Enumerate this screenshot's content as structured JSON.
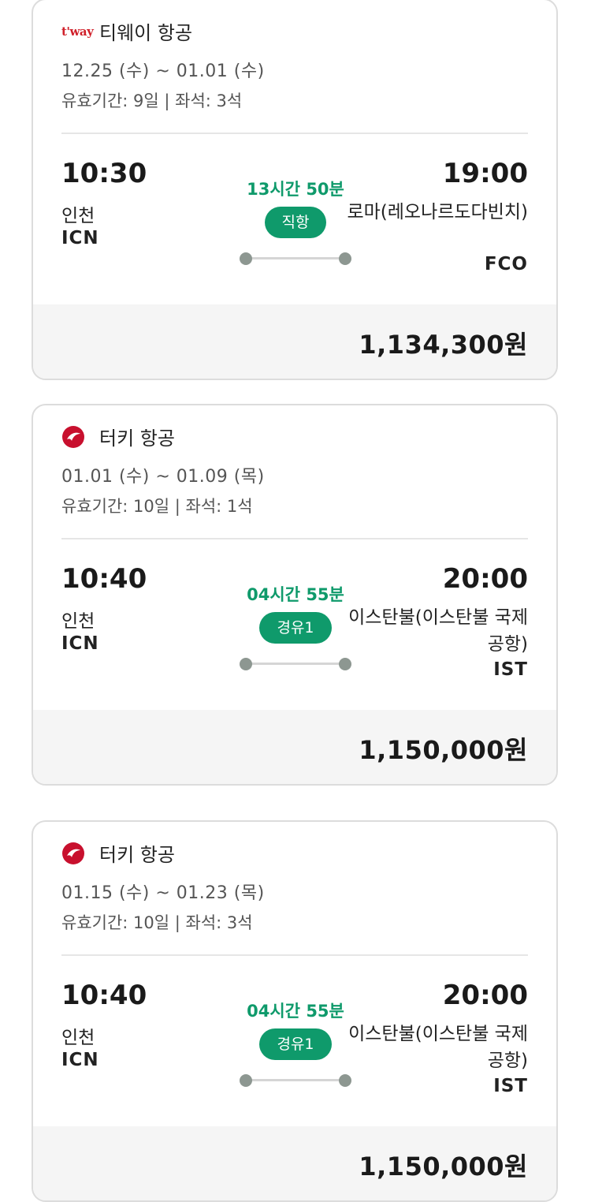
{
  "colors": {
    "accent": "#0f9a6b",
    "price_bg": "#f5f5f5",
    "turkish_red": "#c8102e",
    "tway_red": "#d0202a"
  },
  "flights": [
    {
      "airline_logo_text": "t'way",
      "airline_logo_icon": "tway-logo",
      "airline": "티웨이 항공",
      "dates": "12.25 (수) ~ 01.01 (수)",
      "validity": "유효기간: 9일 | 좌석: 3석",
      "dep_time": "10:30",
      "dep_city": "인천",
      "dep_code": "ICN",
      "duration": "13시간 50분",
      "stop_label": "직항",
      "arr_time": "19:00",
      "arr_city": "로마(레오나르도다빈치)",
      "arr_code": "FCO",
      "price": "1,134,300원"
    },
    {
      "airline_logo_icon": "turkish-airlines-logo",
      "airline": "터키 항공",
      "dates": "01.01 (수) ~ 01.09 (목)",
      "validity": "유효기간: 10일 | 좌석: 1석",
      "dep_time": "10:40",
      "dep_city": "인천",
      "dep_code": "ICN",
      "duration": "04시간 55분",
      "stop_label": "경유1",
      "arr_time": "20:00",
      "arr_city": "이스탄불(이스탄불 국제공항)",
      "arr_code": "IST",
      "price": "1,150,000원"
    },
    {
      "airline_logo_icon": "turkish-airlines-logo",
      "airline": "터키 항공",
      "dates": "01.15 (수) ~ 01.23 (목)",
      "validity": "유효기간: 10일 | 좌석: 3석",
      "dep_time": "10:40",
      "dep_city": "인천",
      "dep_code": "ICN",
      "duration": "04시간 55분",
      "stop_label": "경유1",
      "arr_time": "20:00",
      "arr_city": "이스탄불(이스탄불 국제공항)",
      "arr_code": "IST",
      "price": "1,150,000원"
    }
  ]
}
